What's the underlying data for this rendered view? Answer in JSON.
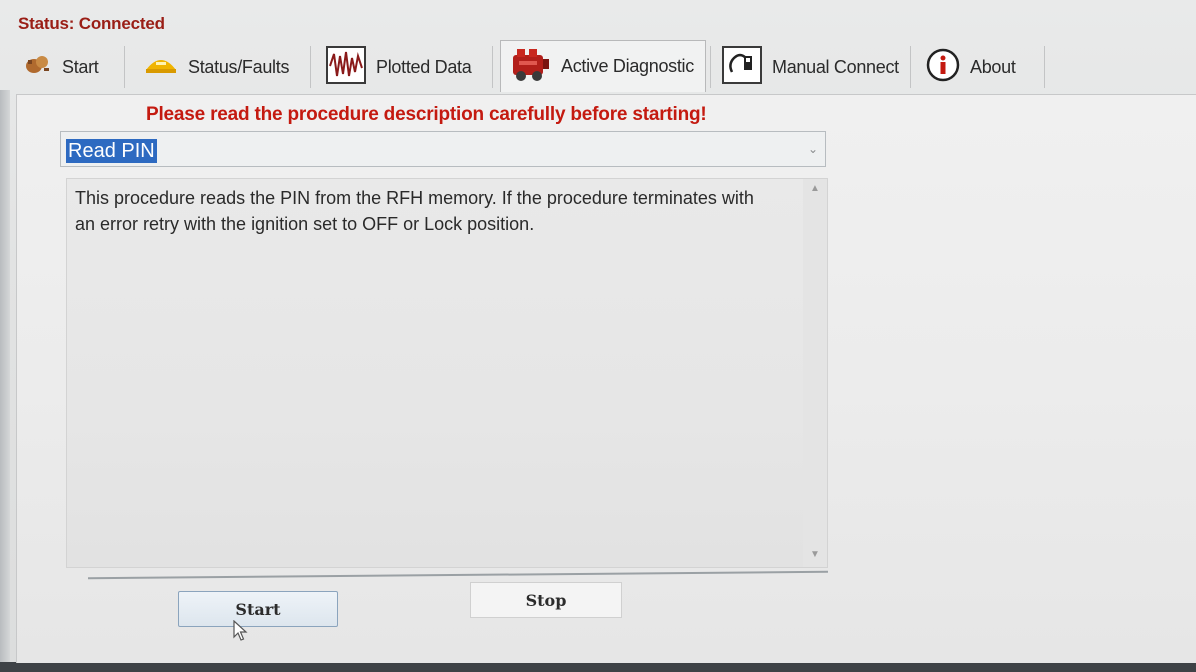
{
  "status": {
    "text": "Status: Connected",
    "color": "#9a1e16"
  },
  "tabs": [
    {
      "label": "Start",
      "icon": "engine-icon",
      "active": false
    },
    {
      "label": "Status/Faults",
      "icon": "fault-lamp-icon",
      "active": false
    },
    {
      "label": "Plotted Data",
      "icon": "waveform-icon",
      "active": false
    },
    {
      "label": "Active Diagnostic",
      "icon": "engine-block-icon",
      "active": true
    },
    {
      "label": "Manual Connect",
      "icon": "connector-icon",
      "active": false
    },
    {
      "label": "About",
      "icon": "info-icon",
      "active": false
    }
  ],
  "warning": {
    "text": "Please read the procedure description carefully before starting!",
    "color": "#c41a10"
  },
  "procedure_select": {
    "selected": "Read PIN"
  },
  "description": {
    "text": "This procedure reads the PIN from the RFH memory. If the procedure terminates with an error retry with the ignition set to OFF or Lock position."
  },
  "buttons": {
    "start_label": "Start",
    "stop_label": "Stop"
  }
}
